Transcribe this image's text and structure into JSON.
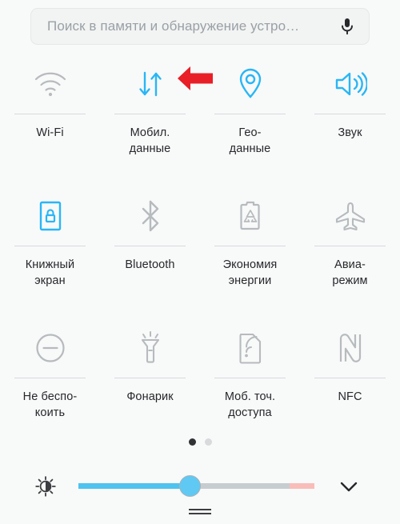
{
  "search": {
    "placeholder": "Поиск в памяти и обнаружение устро…",
    "value": "",
    "mic_icon": "microphone-icon"
  },
  "tiles": [
    {
      "id": "wifi",
      "label": "Wi-Fi",
      "icon": "wifi-icon",
      "state": "off",
      "color": "#b7bbbe"
    },
    {
      "id": "mobile-data",
      "label": "Мобил.\nданные",
      "icon": "mobile-data-icon",
      "state": "on",
      "color": "#29b6f6"
    },
    {
      "id": "location",
      "label": "Гео-\nданные",
      "icon": "location-pin-icon",
      "state": "on",
      "color": "#29b6f6"
    },
    {
      "id": "sound",
      "label": "Звук",
      "icon": "speaker-icon",
      "state": "on",
      "color": "#29b6f6"
    },
    {
      "id": "rotation-lock",
      "label": "Книжный\nэкран",
      "icon": "rotation-lock-icon",
      "state": "on",
      "color": "#29b6f6"
    },
    {
      "id": "bluetooth",
      "label": "Bluetooth",
      "icon": "bluetooth-icon",
      "state": "off",
      "color": "#b7bbbe"
    },
    {
      "id": "battery-saver",
      "label": "Экономия\nэнергии",
      "icon": "battery-saver-icon",
      "state": "off",
      "color": "#b7bbbe"
    },
    {
      "id": "airplane-mode",
      "label": "Авиа-\nрежим",
      "icon": "airplane-icon",
      "state": "off",
      "color": "#b7bbbe"
    },
    {
      "id": "do-not-disturb",
      "label": "Не беспо-\nкоить",
      "icon": "do-not-disturb-icon",
      "state": "off",
      "color": "#b7bbbe"
    },
    {
      "id": "flashlight",
      "label": "Фонарик",
      "icon": "flashlight-icon",
      "state": "off",
      "color": "#b7bbbe"
    },
    {
      "id": "hotspot",
      "label": "Моб. точ.\nдоступа",
      "icon": "hotspot-icon",
      "state": "off",
      "color": "#b7bbbe"
    },
    {
      "id": "nfc",
      "label": "NFC",
      "icon": "nfc-icon",
      "state": "off",
      "color": "#b7bbbe"
    }
  ],
  "annotation": {
    "type": "arrow-left",
    "color": "#e81f26",
    "points_at": "mobile-data"
  },
  "pagination": {
    "pages": 2,
    "current": 1
  },
  "brightness": {
    "icon": "brightness-auto-icon",
    "percent": 47,
    "fill_color": "#4ec3ef",
    "track_color": "#c6cdd0",
    "warn_color": "#f9bdb9",
    "expand_icon": "chevron-down-icon"
  },
  "drag_handle": {
    "icon": "drag-handle-icon"
  }
}
